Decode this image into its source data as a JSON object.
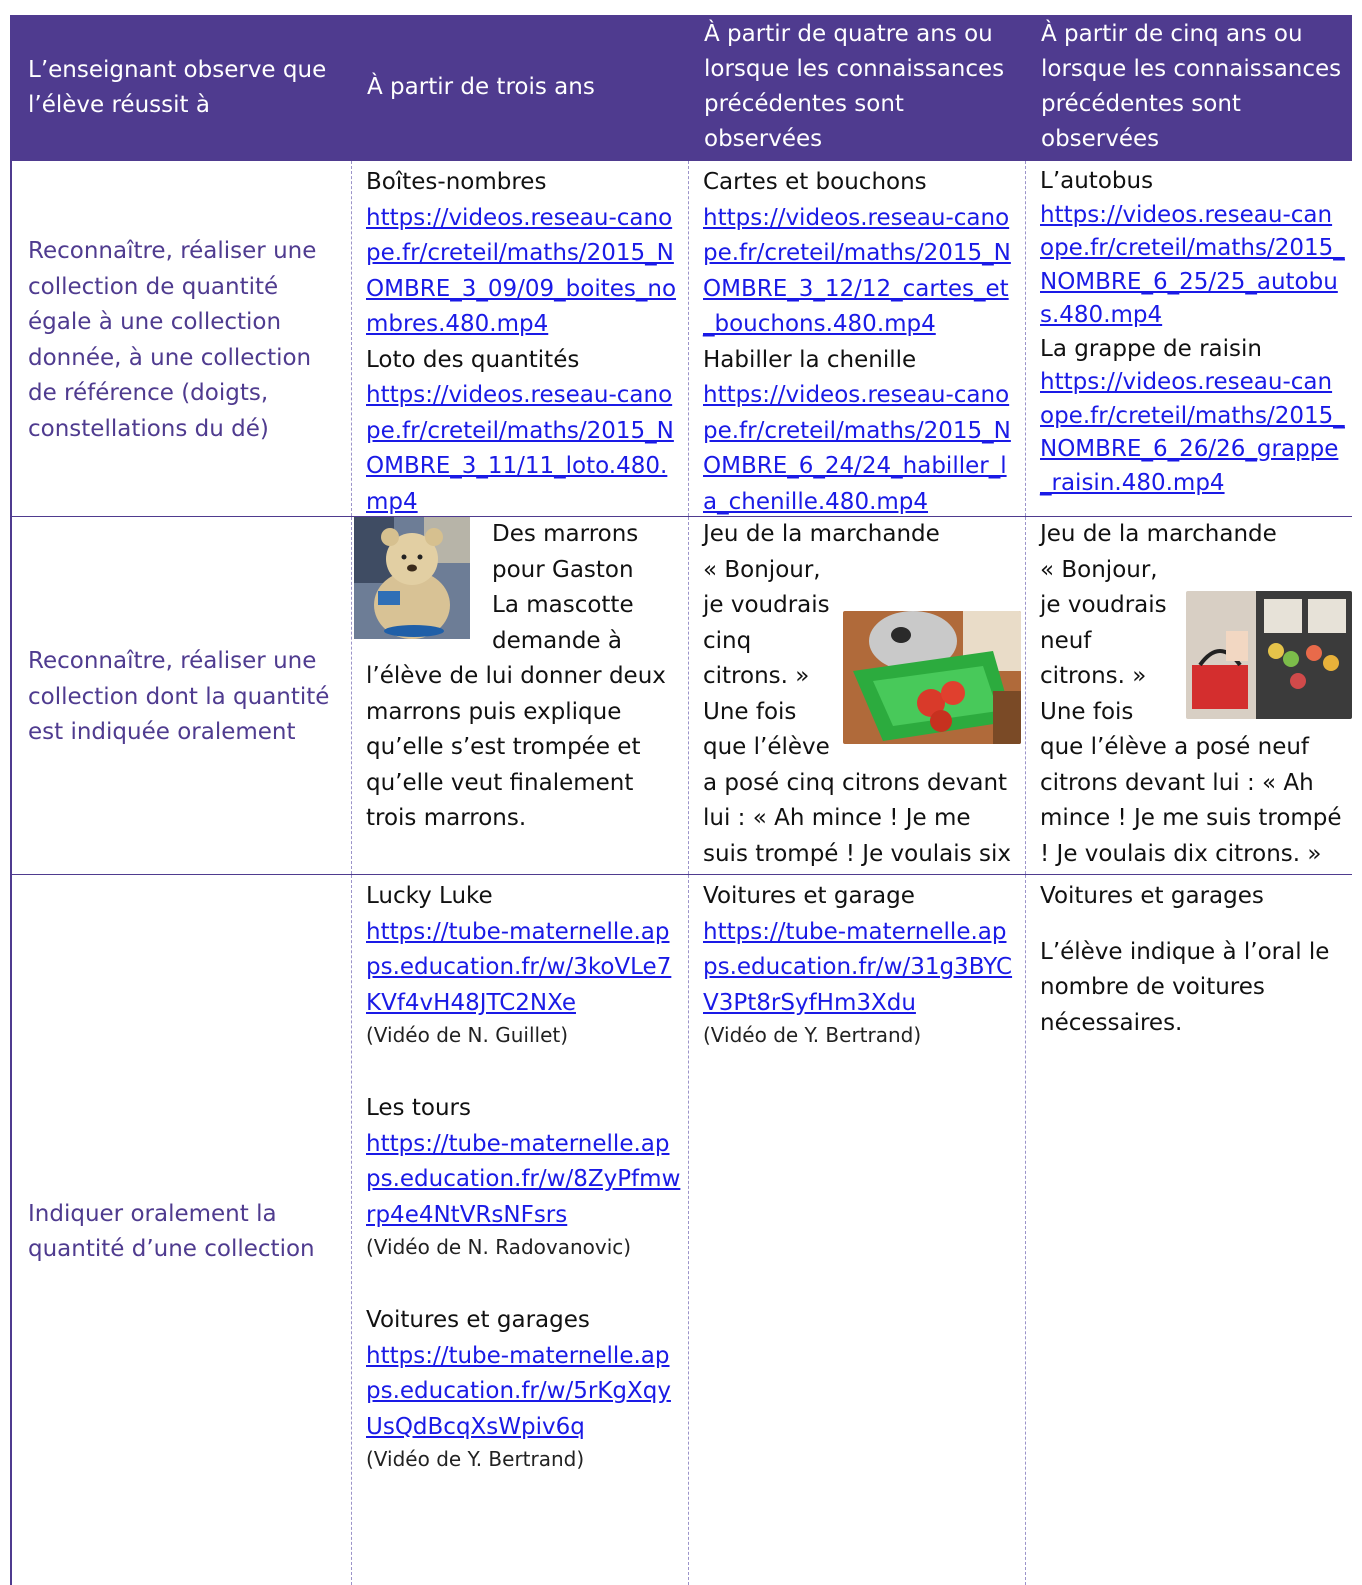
{
  "header": {
    "col1": "L’enseignant observe que l’élève réussit à",
    "col2": "À partir de trois ans",
    "col3": "À partir de quatre ans ou lorsque les connaissances précédentes sont observées",
    "col4": "À partir de cinq ans ou lorsque les connaissances précédentes sont observées"
  },
  "row1": {
    "lead": "Reconnaître, réaliser une collection de quantité égale à une collection donnée, à une collection de référence (doigts, constellations du dé)",
    "c2": {
      "t1": "Boîtes-nombres",
      "l1": "https://videos.reseau-canope.fr/creteil/maths/2015_NOMBRE_3_09/09_boites_nombres.480.mp4",
      "t2": "Loto des quantités",
      "l2": "https://videos.reseau-canope.fr/creteil/maths/2015_NOMBRE_3_11/11_loto.480.mp4"
    },
    "c3": {
      "t1": "Cartes et bouchons",
      "l1": "https://videos.reseau-canope.fr/creteil/maths/2015_NOMBRE_3_12/12_cartes_et_bouchons.480.mp4",
      "t2": "Habiller la chenille",
      "l2": "https://videos.reseau-canope.fr/creteil/maths/2015_NOMBRE_6_24/24_habiller_la_chenille.480.mp4"
    },
    "c4": {
      "t1": "L’autobus",
      "l1": "https://videos.reseau-canope.fr/creteil/maths/2015_NOMBRE_6_25/25_autobus.480.mp4",
      "t2": "La grappe de raisin",
      "l2": "https://videos.reseau-canope.fr/creteil/maths/2015_NOMBRE_6_26/26_grappe_raisin.480.mp4"
    }
  },
  "row2": {
    "lead": "Reconnaître, réaliser une collection dont la quantité est indiquée oralement",
    "c2": {
      "title": "Des marrons pour Gaston",
      "text": "La mascotte demande à l’élève de lui donner deux marrons puis explique qu’elle s’est trompée et qu’elle veut finalement trois marrons."
    },
    "c3": {
      "title": "Jeu de la marchande",
      "text": "« Bonjour, je voudrais cinq citrons. » Une fois que l’élève a posé cinq citrons devant lui : « Ah mince ! Je me suis trompé ! Je voulais six citrons. »"
    },
    "c4": {
      "title": "Jeu de la marchande",
      "text": "« Bonjour, je voudrais neuf citrons. » Une fois que l’élève a posé neuf citrons devant lui : « Ah mince ! Je me suis trompé ! Je voulais dix citrons. »"
    }
  },
  "row3": {
    "lead": "Indiquer oralement la quantité d’une collection",
    "c2": {
      "t1": "Lucky Luke",
      "l1": "https://tube-maternelle.apps.education.fr/w/3koVLe7KVf4vH48JTC2NXe",
      "cr1": "(Vidéo de N. Guillet)",
      "t2": "Les tours",
      "l2": "https://tube-maternelle.apps.education.fr/w/8ZyPfmwrp4e4NtVRsNFsrs",
      "cr2": "(Vidéo de N. Radovanovic)",
      "t3": "Voitures et garages",
      "l3": "https://tube-maternelle.apps.education.fr/w/5rKgXqyUsQdBcqXsWpiv6q",
      "cr3": "(Vidéo de Y. Bertrand)"
    },
    "c3": {
      "t1": "Voitures et garage",
      "l1": "https://tube-maternelle.apps.education.fr/w/31g3BYCV3Pt8rSyfHm3Xdu",
      "cr1": "(Vidéo de Y. Bertrand)"
    },
    "c4": {
      "t1": "Voitures et garages",
      "text": "L’élève indique à l’oral le nombre de voitures nécessaires."
    }
  }
}
